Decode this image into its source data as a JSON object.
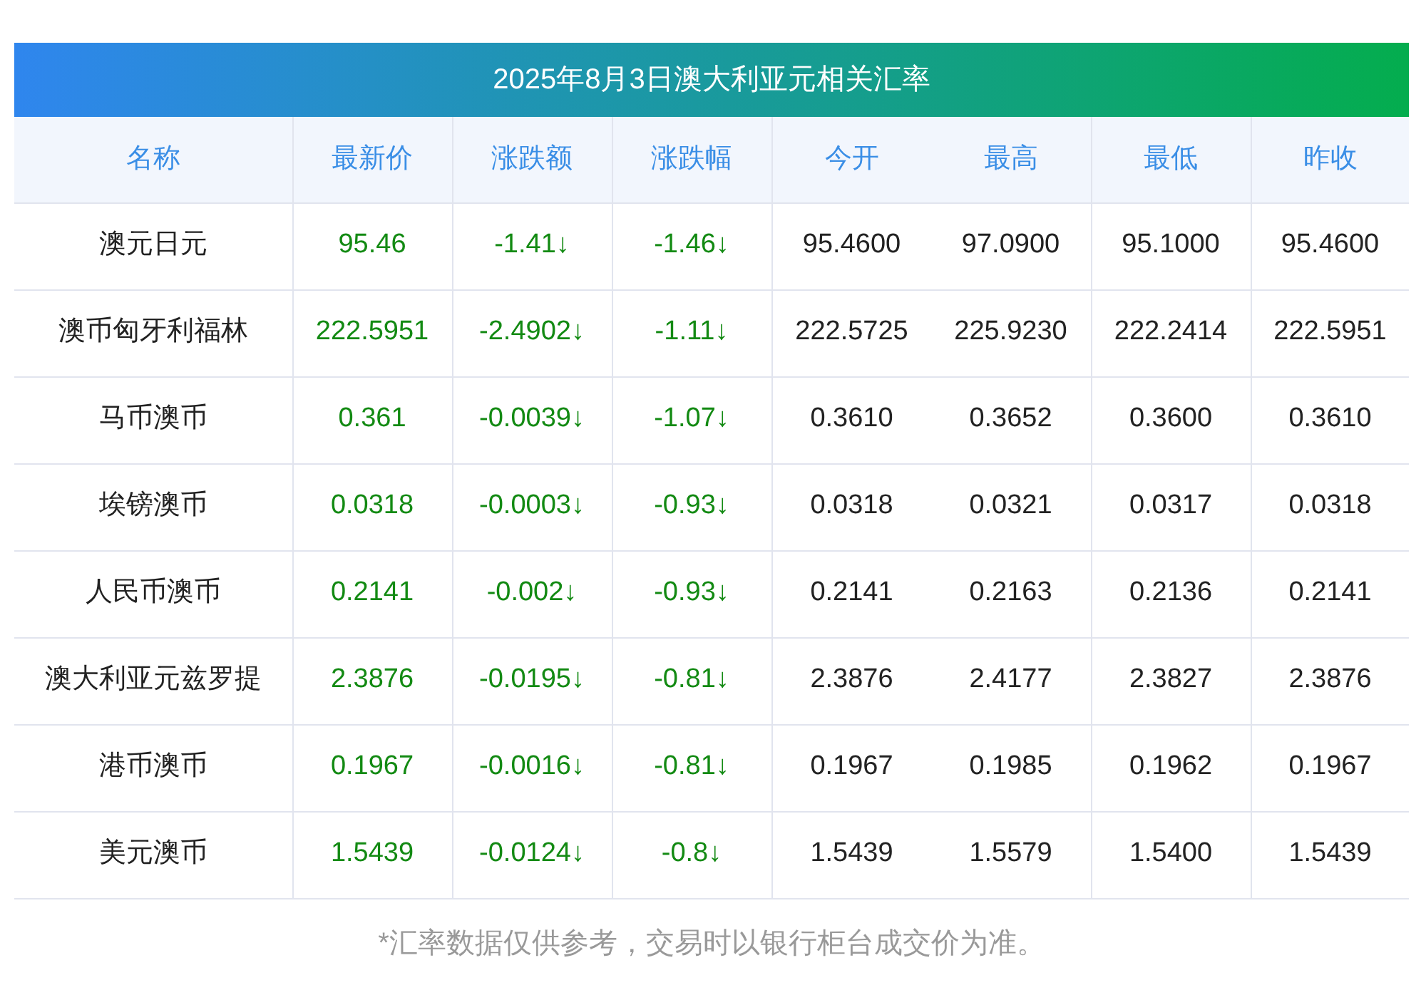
{
  "title": "2025年8月3日澳大利亚元相关汇率",
  "columns": [
    "名称",
    "最新价",
    "涨跌额",
    "涨跌幅",
    "今开",
    "最高",
    "最低",
    "昨收"
  ],
  "rows": [
    {
      "kind": "down",
      "cells": [
        "澳元日元",
        "95.46",
        "-1.41↓",
        "-1.46↓",
        "95.4600",
        "97.0900",
        "95.1000",
        "95.4600"
      ]
    },
    {
      "kind": "down",
      "cells": [
        "澳币匈牙利福林",
        "222.5951",
        "-2.4902↓",
        "-1.11↓",
        "222.5725",
        "225.9230",
        "222.2414",
        "222.5951"
      ]
    },
    {
      "kind": "down",
      "cells": [
        "马币澳币",
        "0.361",
        "-0.0039↓",
        "-1.07↓",
        "0.3610",
        "0.3652",
        "0.3600",
        "0.3610"
      ]
    },
    {
      "kind": "down",
      "cells": [
        "埃镑澳币",
        "0.0318",
        "-0.0003↓",
        "-0.93↓",
        "0.0318",
        "0.0321",
        "0.0317",
        "0.0318"
      ]
    },
    {
      "kind": "down",
      "cells": [
        "人民币澳币",
        "0.2141",
        "-0.002↓",
        "-0.93↓",
        "0.2141",
        "0.2163",
        "0.2136",
        "0.2141"
      ]
    },
    {
      "kind": "down",
      "cells": [
        "澳大利亚元兹罗提",
        "2.3876",
        "-0.0195↓",
        "-0.81↓",
        "2.3876",
        "2.4177",
        "2.3827",
        "2.3876"
      ]
    },
    {
      "kind": "down",
      "cells": [
        "港币澳币",
        "0.1967",
        "-0.0016↓",
        "-0.81↓",
        "0.1967",
        "0.1985",
        "0.1962",
        "0.1967"
      ]
    },
    {
      "kind": "down",
      "cells": [
        "美元澳币",
        "1.5439",
        "-0.0124↓",
        "-0.8↓",
        "1.5439",
        "1.5579",
        "1.5400",
        "1.5439"
      ]
    }
  ],
  "footnote": "*汇率数据仅供参考，交易时以银行柜台成交价为准。"
}
